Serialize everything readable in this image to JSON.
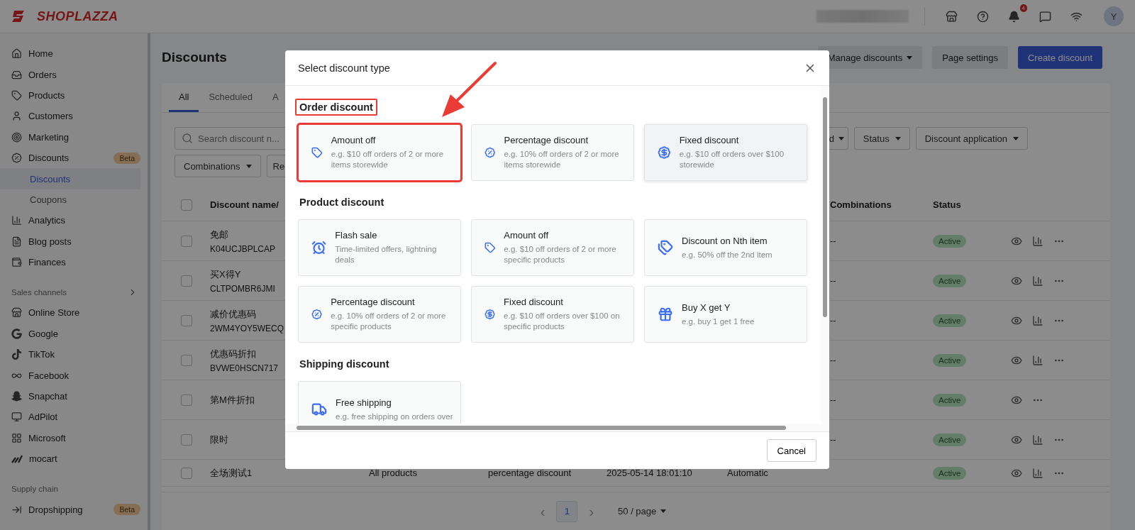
{
  "topbar": {
    "logo": "SHOPLAZZA",
    "notification_count": "4",
    "avatar": "Y"
  },
  "sidebar": {
    "groups": [
      {
        "items": [
          {
            "label": "Home",
            "selected": false
          },
          {
            "label": "Orders",
            "selected": false
          },
          {
            "label": "Products",
            "selected": false
          },
          {
            "label": "Customers",
            "selected": false
          },
          {
            "label": "Marketing",
            "selected": false
          },
          {
            "label": "Discounts",
            "selected": false,
            "badge": "Beta",
            "children": [
              {
                "label": "Discounts",
                "selected": true
              },
              {
                "label": "Coupons",
                "selected": false
              }
            ]
          },
          {
            "label": "Analytics",
            "selected": false
          },
          {
            "label": "Blog posts",
            "selected": false
          },
          {
            "label": "Finances",
            "selected": false
          }
        ]
      },
      {
        "title": "Sales channels",
        "items": [
          {
            "label": "Online Store",
            "selected": false
          },
          {
            "label": "Google",
            "selected": false
          },
          {
            "label": "TikTok",
            "selected": false
          },
          {
            "label": "Facebook",
            "selected": false
          },
          {
            "label": "Snapchat",
            "selected": false
          },
          {
            "label": "AdPilot",
            "selected": false
          },
          {
            "label": "Microsoft",
            "selected": false
          },
          {
            "label": "mocart",
            "selected": false
          }
        ]
      },
      {
        "title": "Supply chain",
        "items": [
          {
            "label": "Dropshipping",
            "selected": false,
            "badge": "Beta"
          }
        ]
      }
    ]
  },
  "page": {
    "title": "Discounts",
    "actions": [
      {
        "label": "Manage discounts",
        "kind": "dropdown"
      },
      {
        "label": "Page settings",
        "kind": "secondary"
      },
      {
        "label": "Create discount",
        "kind": "primary"
      }
    ]
  },
  "tabs": [
    {
      "label": "All",
      "selected": true
    },
    {
      "label": "Scheduled",
      "selected": false
    },
    {
      "label": "A",
      "selected": false
    }
  ],
  "search": {
    "placeholder": "Search discount n..."
  },
  "filters_right": [
    "d",
    "Status",
    "Discount application"
  ],
  "filters_left": [
    {
      "label": "Combinations",
      "kind": "dropdown"
    },
    {
      "label": "Re",
      "kind": "cut"
    }
  ],
  "table": {
    "header": {
      "checked": false,
      "name": "Discount name/",
      "combinations": "Combinations",
      "status": "Status"
    },
    "rows": [
      {
        "name": "免邮",
        "code": "K04UCJBPLCAP",
        "combinations": "--",
        "status": "Active",
        "checked": false,
        "has_stats": true
      },
      {
        "name": "买X得Y",
        "code": "CLTPOMBR6JMI",
        "combinations": "--",
        "status": "Active",
        "checked": false,
        "has_stats": true
      },
      {
        "name": "减价优惠码",
        "code": "2WM4YOY5WECQ",
        "combinations": "--",
        "status": "Active",
        "checked": false,
        "has_stats": true
      },
      {
        "name": "优惠码折扣",
        "code": "BVWE0HSCN717",
        "combinations": "--",
        "status": "Active",
        "checked": false,
        "has_stats": true
      },
      {
        "name": "第M件折扣",
        "combinations": "--",
        "status": "Active",
        "checked": false,
        "has_stats": false
      },
      {
        "name": "限时",
        "combinations": "--",
        "status": "Active",
        "checked": false,
        "has_stats": true
      },
      {
        "name": "全场测试1",
        "applies_to": "All products",
        "type": "percentage discount",
        "start_time": "2025-05-14 18:01:10",
        "method": "Automatic",
        "status": "Active",
        "checked": false,
        "has_stats": true
      }
    ]
  },
  "pagination": {
    "prev": "‹",
    "pages": [
      {
        "label": "1",
        "selected": true
      }
    ],
    "next": "›",
    "page_size": "50 / page"
  },
  "modal": {
    "title": "Select discount type",
    "sections": [
      {
        "title": "Order discount",
        "highlighted": true,
        "cards": [
          {
            "title": "Amount off",
            "description": "e.g. $10 off orders of 2 or more items storewide",
            "highlighted": true,
            "hovered": false
          },
          {
            "title": "Percentage discount",
            "description": "e.g. 10% off orders of 2 or more items storewide",
            "highlighted": false,
            "hovered": false
          },
          {
            "title": "Fixed discount",
            "description": "e.g. $10 off orders over $100 storewide",
            "highlighted": false,
            "hovered": true
          }
        ]
      },
      {
        "title": "Product discount",
        "highlighted": false,
        "cards": [
          {
            "title": "Flash sale",
            "description": "Time-limited offers, lightning deals",
            "highlighted": false,
            "hovered": false
          },
          {
            "title": "Amount off",
            "description": "e.g. $10 off orders of 2 or more specific products",
            "highlighted": false,
            "hovered": false
          },
          {
            "title": "Discount on Nth item",
            "description": "e.g. 50% off the 2nd item",
            "highlighted": false,
            "hovered": false
          },
          {
            "title": "Percentage discount",
            "description": "e.g. 10% off orders of 2 or more specific products",
            "highlighted": false,
            "hovered": false
          },
          {
            "title": "Fixed discount",
            "description": "e.g. $10 off orders over $100 on specific products",
            "highlighted": false,
            "hovered": false
          },
          {
            "title": "Buy X get Y",
            "description": "e.g. buy 1 get 1 free",
            "highlighted": false,
            "hovered": false
          }
        ]
      },
      {
        "title": "Shipping discount",
        "highlighted": false,
        "cards": [
          {
            "title": "Free shipping",
            "description": "e.g. free shipping on orders over",
            "highlighted": false,
            "hovered": false
          }
        ]
      }
    ],
    "cancel": "Cancel"
  }
}
